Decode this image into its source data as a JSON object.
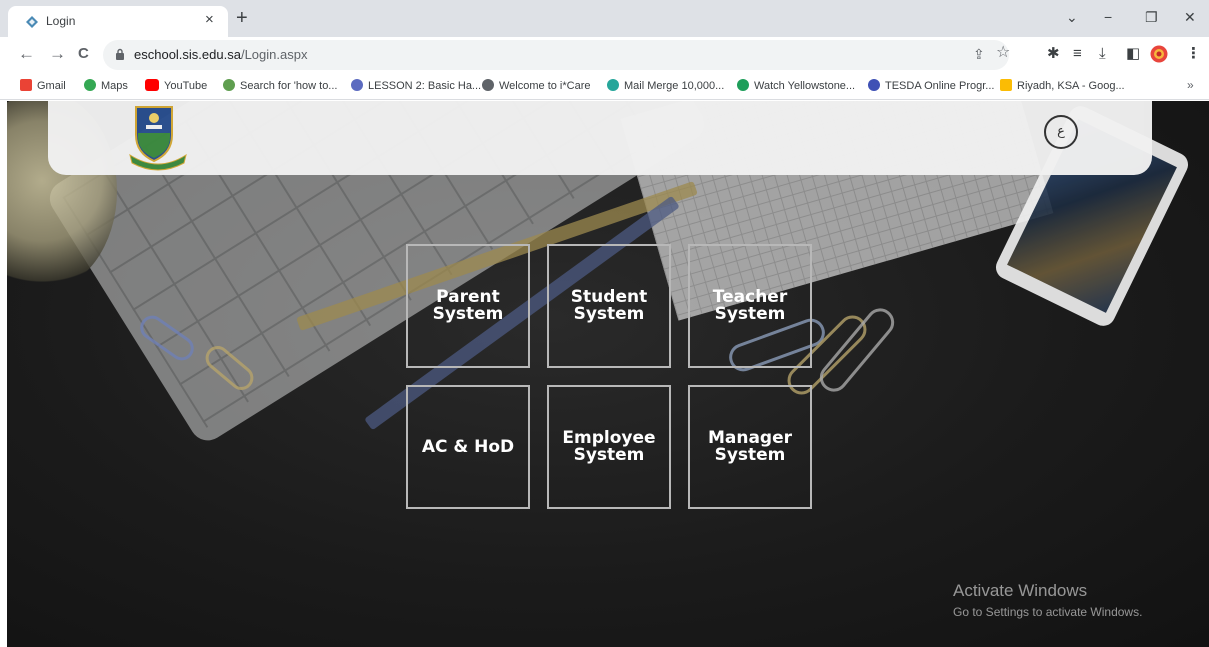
{
  "browser": {
    "tab_title": "Login",
    "tab_close": "×",
    "new_tab": "+",
    "url_host": "eschool.sis.edu.sa",
    "url_path": "/Login.aspx",
    "window_controls": {
      "dropdown": "⌄",
      "minimize": "−",
      "maximize": "❐",
      "close": "✕"
    },
    "nav": {
      "back": "←",
      "forward": "→",
      "reload": "C"
    },
    "toolbar_icons": {
      "share": "⇪",
      "star": "☆",
      "extensions": "✱",
      "media": "≡",
      "download": "⤓",
      "sidebar": "◧",
      "menu": "⋮"
    }
  },
  "bookmarks": [
    {
      "label": "Gmail",
      "color": "#ea4335"
    },
    {
      "label": "Maps",
      "color": "#34a853"
    },
    {
      "label": "YouTube",
      "color": "#ff0000"
    },
    {
      "label": "Search for 'how to...",
      "color": "#5f9e4f"
    },
    {
      "label": "LESSON 2: Basic Ha...",
      "color": "#5c6bc0"
    },
    {
      "label": "Welcome to i*Care",
      "color": "#5f6368"
    },
    {
      "label": "Mail Merge 10,000...",
      "color": "#26a69a"
    },
    {
      "label": "Watch Yellowstone...",
      "color": "#1e9e5a"
    },
    {
      "label": "TESDA Online Progr...",
      "color": "#3f51b5"
    },
    {
      "label": "Riyadh, KSA - Goog...",
      "color": "#fbbc04"
    }
  ],
  "bookmarks_more": "»",
  "header": {
    "language_button": "ع"
  },
  "tiles": [
    {
      "label": "Parent\nSystem"
    },
    {
      "label": "Student\nSystem"
    },
    {
      "label": "Teacher\nSystem"
    },
    {
      "label": "AC & HoD"
    },
    {
      "label": "Employee\nSystem"
    },
    {
      "label": "Manager\nSystem"
    }
  ],
  "watermark": {
    "title": "Activate Windows",
    "subtitle": "Go to Settings to activate Windows."
  }
}
